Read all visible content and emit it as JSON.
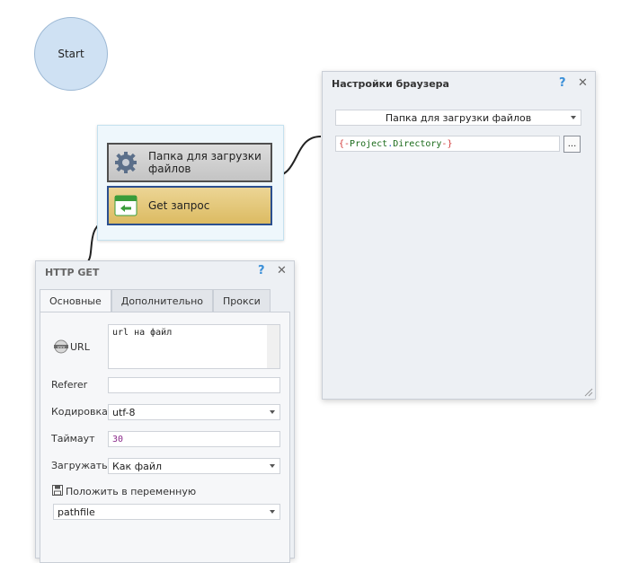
{
  "start_node": {
    "label": "Start"
  },
  "actions": [
    {
      "label": "Папка для загрузки файлов",
      "icon": "gear-icon"
    },
    {
      "label": "Get запрос",
      "icon": "get-request-icon"
    }
  ],
  "browser_settings": {
    "title": "Настройки браузера",
    "help": "?",
    "close": "✕",
    "dropdown_value": "Папка для загрузки файлов",
    "path_parts": {
      "open": "{-",
      "project": "Project",
      "dot": ".",
      "directory": "Directory",
      "close": "-}"
    },
    "browse_button": "..."
  },
  "http_get": {
    "title": "HTTP GET",
    "help": "?",
    "close": "✕",
    "tabs": [
      "Основные",
      "Дополнительно",
      "Прокси"
    ],
    "url_label": "URL",
    "url_value": "url на файл",
    "referer_label": "Referer",
    "referer_value": "",
    "encoding_label": "Кодировка",
    "encoding_value": "utf-8",
    "timeout_label": "Таймаут",
    "timeout_value": "30",
    "download_label": "Загружать",
    "download_value": "Как файл",
    "save_to_var_label": "Положить в переменную",
    "variable_value": "pathfile"
  },
  "colors": {
    "start_fill": "#cfe1f3",
    "folder_action": "#c4c4c4",
    "get_action": "#dcbb62",
    "selected_border": "#2b4f8f",
    "help_icon": "#3a8fd8"
  }
}
